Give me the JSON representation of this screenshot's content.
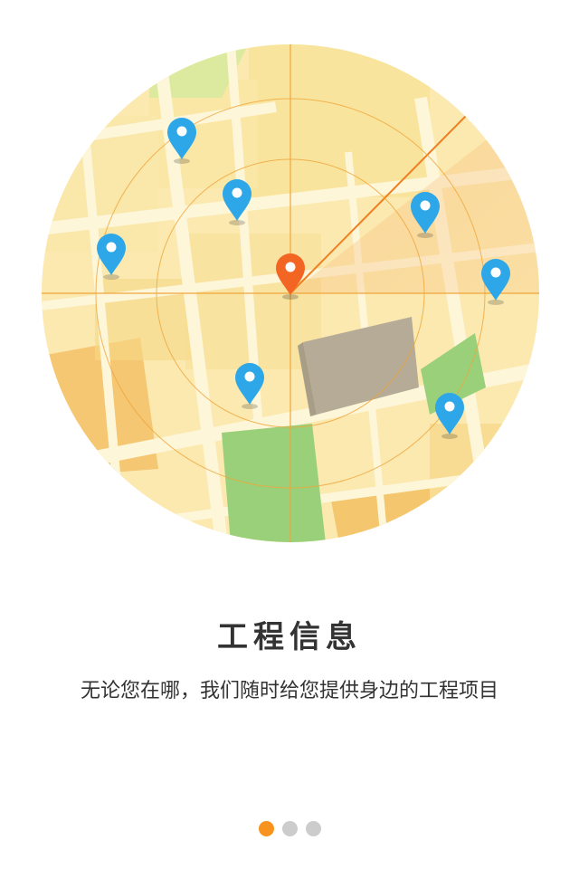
{
  "onboarding": {
    "title": "工程信息",
    "description": "无论您在哪，我们随时给您提供身边的工程项目"
  },
  "illustration": {
    "current_location_icon": "location-pin-icon",
    "nearby_project_icon": "location-pin-icon",
    "nearby_project_count": 7
  },
  "pager": {
    "page_count": 3,
    "current_page": 1
  },
  "colors": {
    "accent": "#f7931e",
    "current_pin": "#f26522",
    "project_pin": "#2ea7e8",
    "map_base": "#fbe7a6",
    "park": "#9bd07a",
    "text": "#333333",
    "dot_inactive": "#cccccc"
  }
}
